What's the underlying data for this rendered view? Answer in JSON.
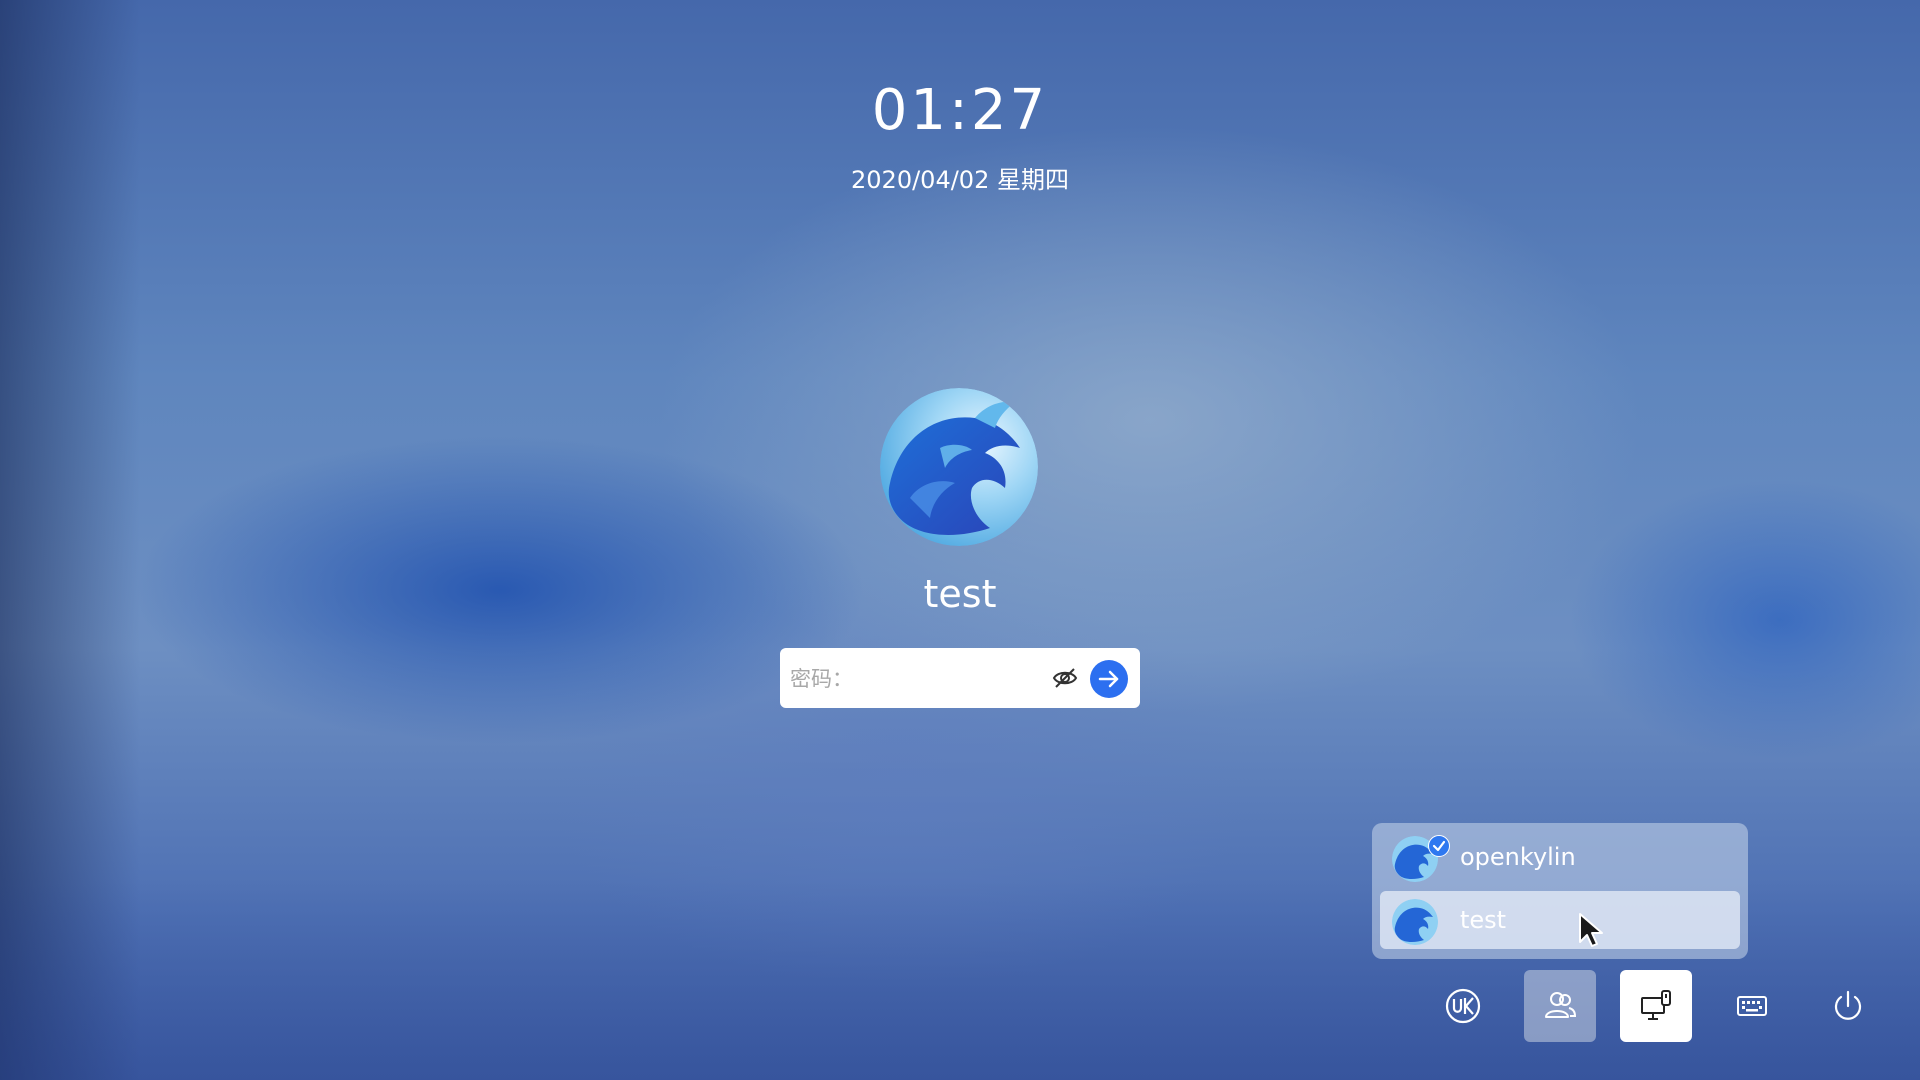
{
  "clock": {
    "time": "01:27",
    "date": "2020/04/02 星期四"
  },
  "login": {
    "username": "test",
    "password_placeholder": "密码：",
    "password_value": ""
  },
  "user_list": [
    {
      "name": "openkylin",
      "logged_in": true
    },
    {
      "name": "test",
      "logged_in": false,
      "highlighted": true
    }
  ],
  "toolbar": [
    {
      "icon": "ukui-logo-icon"
    },
    {
      "icon": "switch-user-icon",
      "active": true
    },
    {
      "icon": "remote-desktop-icon",
      "selected": true
    },
    {
      "icon": "virtual-keyboard-icon"
    },
    {
      "icon": "power-icon"
    }
  ],
  "colors": {
    "accent": "#2c6ff0",
    "text": "#ffffff"
  }
}
